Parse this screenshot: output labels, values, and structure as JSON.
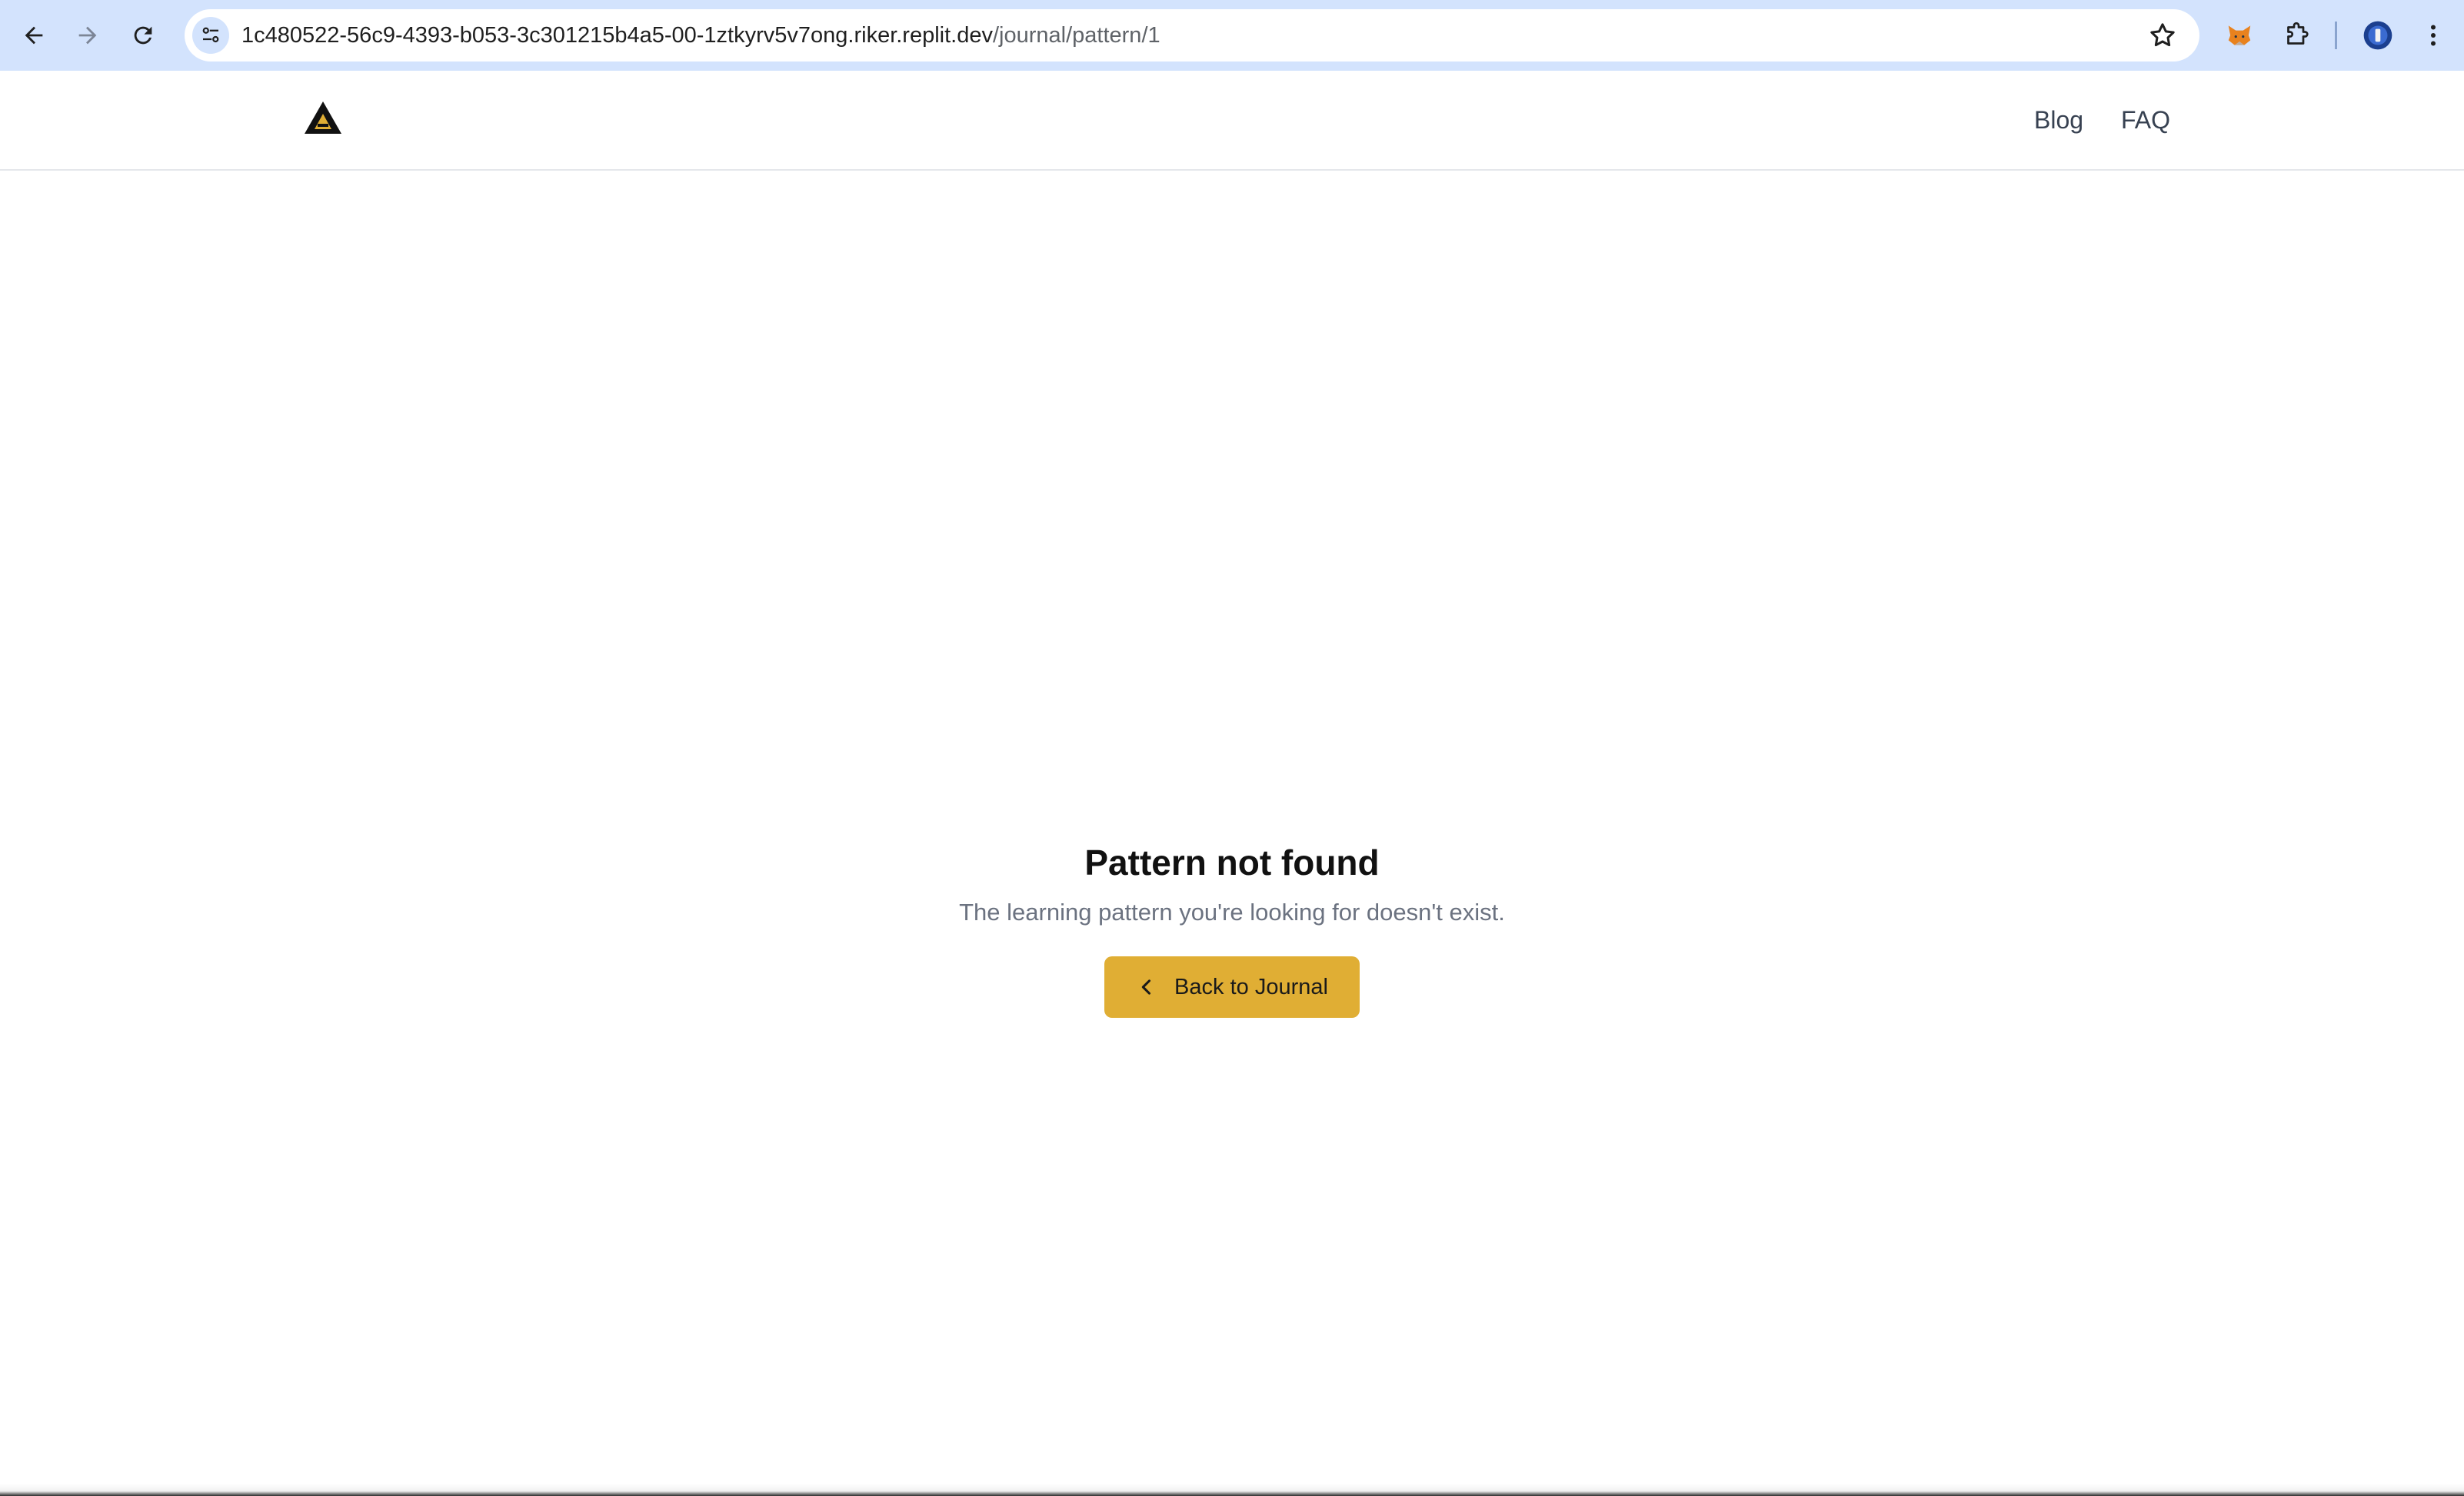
{
  "browser": {
    "url_host": "1c480522-56c9-4393-b053-3c301215b4a5-00-1ztkyrv5v7ong.riker.replit.dev",
    "url_path": "/journal/pattern/1",
    "icons": [
      "back-arrow-icon",
      "forward-arrow-icon",
      "reload-icon",
      "site-info-icon",
      "bookmark-star-icon",
      "fox-extension-icon",
      "puzzle-extension-icon",
      "profile-avatar-icon",
      "kebab-menu-icon"
    ],
    "accent_color": "#d3e3fd"
  },
  "header": {
    "logo_icon": "triangle-logo-icon",
    "nav": {
      "blog": "Blog",
      "faq": "FAQ"
    }
  },
  "main": {
    "title": "Pattern not found",
    "message": "The learning pattern you're looking for doesn't exist.",
    "back_button": {
      "label": "Back to Journal",
      "icon": "chevron-left-icon",
      "color": "#e0ae34"
    }
  }
}
